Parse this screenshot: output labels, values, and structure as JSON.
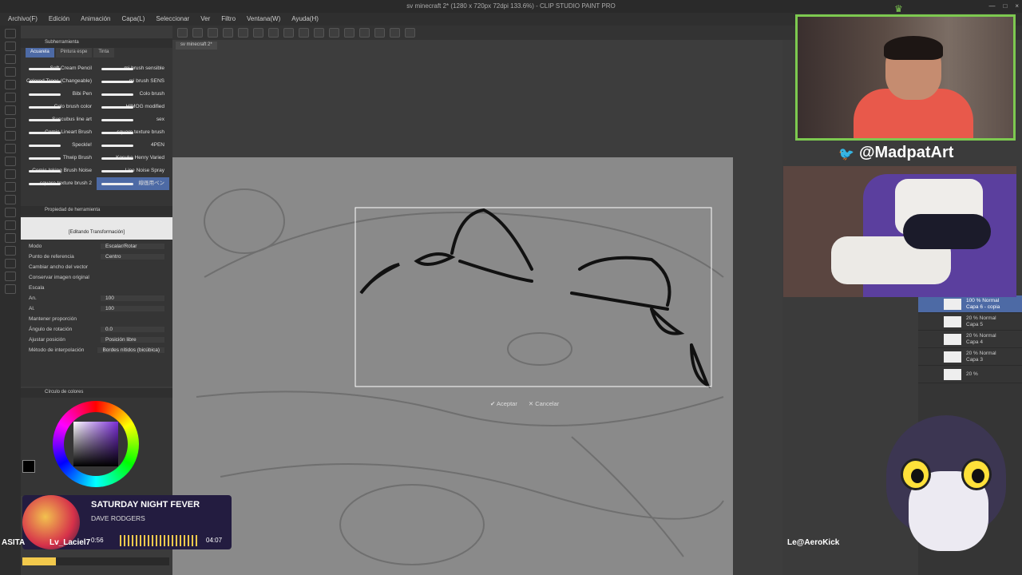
{
  "window": {
    "title": "sv minecraft 2* (1280 x 720px 72dpi 133.6%) - CLIP STUDIO PAINT PRO",
    "controls": [
      "—",
      "□",
      "×"
    ]
  },
  "menu": [
    "Archivo(F)",
    "Edición",
    "Animación",
    "Capa(L)",
    "Seleccionar",
    "Ver",
    "Filtro",
    "Ventana(W)",
    "Ayuda(H)"
  ],
  "subtool": {
    "header": "Subherramienta",
    "tabs": [
      "Acuarela",
      "Pintura espe",
      "Tinta"
    ],
    "brushes": [
      "Soft Cream Pencil",
      "mi brush sensible",
      "Colored Trees (Changeable)",
      "mi brush SENS",
      "Bibi Pen",
      "Colo brush",
      "Colo brush color",
      "HIMOG modified",
      "Succubus line art",
      "sex",
      "Comic Lineart Brush",
      "square texture brush",
      "Speckle!",
      "4PEN",
      "Thwip Brush",
      "Kosuke Henry Varied",
      "Comic Inking Brush Noise",
      "Line Noise Spray",
      "square texture brush 2",
      "線画用ペン"
    ],
    "active_index": 19
  },
  "tool_property": {
    "header": "Propiedad de herramienta",
    "layer_name": "Capa 6 - copia",
    "status": "[Editando Transformación]",
    "rows": [
      {
        "label": "Modo",
        "value": "Escalar/Rotar"
      },
      {
        "label": "Punto de referencia",
        "value": "Centro"
      },
      {
        "label": "Cambiar ancho del vector",
        "value": ""
      },
      {
        "label": "Conservar imagen original",
        "value": ""
      },
      {
        "label": "Escala",
        "value": ""
      },
      {
        "label": "An.",
        "value": "100"
      },
      {
        "label": "Al.",
        "value": "100"
      },
      {
        "label": "Mantener proporción",
        "value": ""
      },
      {
        "label": "Ángulo de rotación",
        "value": "0.0"
      },
      {
        "label": "Ajustar posición",
        "value": "Posición libre"
      },
      {
        "label": "Método de interpolación",
        "value": "Bordes nítidos (bicúbica)"
      }
    ]
  },
  "color_panel": {
    "header": "Círculo de colores",
    "readouts": [
      "0",
      "0",
      "0"
    ]
  },
  "document": {
    "tab": "sv minecraft 2*"
  },
  "transform": {
    "accept": "Aceptar",
    "cancel": "Cancelar"
  },
  "layers": [
    {
      "mode": "100 % Normal",
      "name": "Capa 6 - copia",
      "selected": true
    },
    {
      "mode": "20 % Normal",
      "name": "Capa 5",
      "selected": false
    },
    {
      "mode": "20 % Normal",
      "name": "Capa 4",
      "selected": false
    },
    {
      "mode": "20 % Normal",
      "name": "Capa 3",
      "selected": false
    },
    {
      "mode": "20 %",
      "name": "",
      "selected": false
    }
  ],
  "stream": {
    "twitter_handle": "@MadpatArt",
    "song_title": "SATURDAY NIGHT FEVER",
    "song_artist": "DAVE RODGERS",
    "elapsed": "0:56",
    "duration": "04:07",
    "progress": 0.23,
    "viewer_left_a": "ASITA",
    "viewer_left_b": "Lv_Laciel7",
    "viewer_right": "Le@AeroKick"
  },
  "colors": {
    "accent": "#4d6aa5",
    "cam_border": "#7dc950",
    "music_bg": "#231c40",
    "twitter": "#1da1f2"
  }
}
